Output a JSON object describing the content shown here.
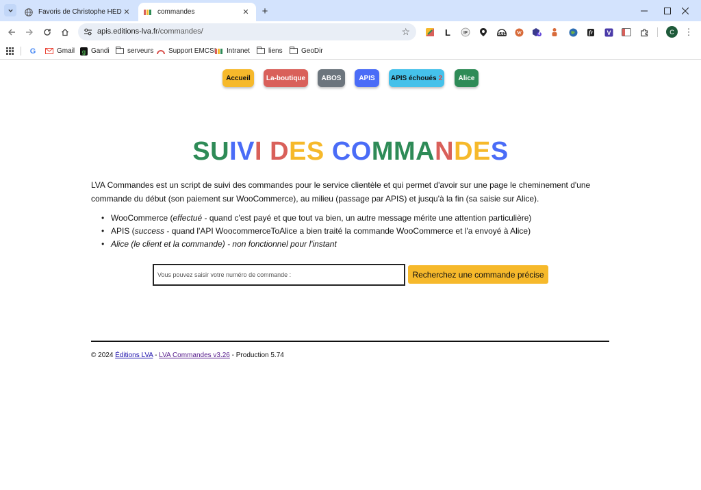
{
  "browser": {
    "tabs": [
      {
        "title": "Favoris de Christophe HÉDÉ / W",
        "active": false,
        "favicon": "globe-icon"
      },
      {
        "title": "commandes",
        "active": true,
        "favicon": "lva-favicon"
      }
    ],
    "url_host": "apis.editions-lva.fr",
    "url_path": "/commandes/",
    "extensions": {
      "badge_061": "0.61",
      "badge_4": "4",
      "fr_label": "fr"
    },
    "profile_initial": "C",
    "bookmarks": [
      {
        "label": "Gmail",
        "icon": "gmail-icon"
      },
      {
        "label": "Gandi",
        "icon": "gandi-icon"
      },
      {
        "label": "serveurs",
        "icon": "folder-icon"
      },
      {
        "label": "Support EMCSI",
        "icon": "emcsi-icon"
      },
      {
        "label": "Intranet",
        "icon": "lva-favicon"
      },
      {
        "label": "liens",
        "icon": "folder-icon"
      },
      {
        "label": "GeoDir",
        "icon": "folder-icon"
      }
    ]
  },
  "nav": {
    "items": [
      {
        "label": "Accueil",
        "color": "#f6b92b",
        "text_color": "#111111"
      },
      {
        "label": "La-boutique",
        "color": "#d9605a",
        "text_color": "#ffffff"
      },
      {
        "label": "ABOS",
        "color": "#6c757d",
        "text_color": "#ffffff"
      },
      {
        "label": "APIS",
        "color": "#4a6cf7",
        "text_color": "#ffffff"
      },
      {
        "label": "APIS échoués",
        "badge": "2",
        "color": "#45c1ea",
        "text_color": "#111111"
      },
      {
        "label": "Alice",
        "color": "#2e8b57",
        "text_color": "#ffffff"
      }
    ]
  },
  "heading": {
    "letters": [
      {
        "c": "S",
        "color": "#2e8b57"
      },
      {
        "c": "U",
        "color": "#2e8b57"
      },
      {
        "c": "I",
        "color": "#4a6cf7"
      },
      {
        "c": "V",
        "color": "#4a6cf7"
      },
      {
        "c": "I",
        "color": "#d9605a"
      },
      {
        "c": " ",
        "color": "#000000"
      },
      {
        "c": "D",
        "color": "#d9605a"
      },
      {
        "c": "E",
        "color": "#f6b92b"
      },
      {
        "c": "S",
        "color": "#f6b92b"
      },
      {
        "c": " ",
        "color": "#000000"
      },
      {
        "c": "C",
        "color": "#4a6cf7"
      },
      {
        "c": "O",
        "color": "#4a6cf7"
      },
      {
        "c": "M",
        "color": "#2e8b57"
      },
      {
        "c": "M",
        "color": "#2e8b57"
      },
      {
        "c": "A",
        "color": "#2e8b57"
      },
      {
        "c": "N",
        "color": "#d9605a"
      },
      {
        "c": "D",
        "color": "#f6b92b"
      },
      {
        "c": "E",
        "color": "#f6b92b"
      },
      {
        "c": "S",
        "color": "#4a6cf7"
      }
    ]
  },
  "intro": "LVA Commandes est un script de suivi des commandes pour le service clientèle et qui permet d'avoir sur une page le cheminement d'une commande du début (son paiement sur WooCommerce), au milieu (passage par APIS) et jusqu'à la fin (sa saisie sur Alice).",
  "features": {
    "woo": {
      "prefix": "WooCommerce (",
      "em": "effectué",
      "suffix": " - quand c'est payé et que tout va bien, un autre message mérite une attention particulière)"
    },
    "apis": {
      "prefix": "APIS (",
      "em": "success",
      "suffix": " - quand l'API WoocommerceToAlice a bien traité la commande WooCommerce et l'a envoyé à Alice)"
    },
    "alice": "Alice (le client et la commande) - non fonctionnel pour l'instant"
  },
  "search": {
    "placeholder": "Vous pouvez saisir votre numéro de commande :",
    "button": "Recherchez une commande précise"
  },
  "footer": {
    "copyright": "© 2024 ",
    "link1": "Éditions LVA",
    "sep": " - ",
    "link2": "LVA Commandes v3.26",
    "suffix": " - Production 5.74"
  }
}
